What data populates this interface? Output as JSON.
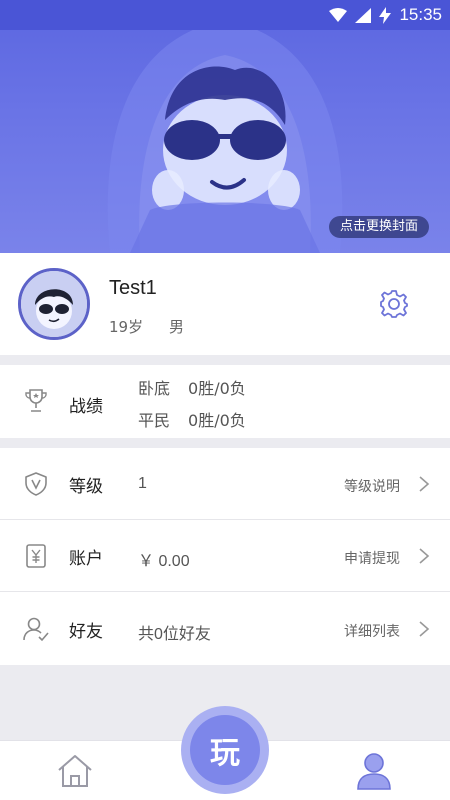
{
  "status_bar": {
    "time": "15:35",
    "icons": [
      "wifi-icon",
      "signal-icon",
      "charging-icon"
    ]
  },
  "cover": {
    "change_cover_label": "点击更换封面"
  },
  "profile": {
    "username": "Test1",
    "age": "19岁",
    "gender": "男",
    "settings_icon": "gear-icon"
  },
  "record": {
    "title": "战绩",
    "lines": [
      {
        "role": "卧底",
        "result": "0胜/0负"
      },
      {
        "role": "平民",
        "result": "0胜/0负"
      }
    ]
  },
  "rows": [
    {
      "id": "level",
      "icon": "shield-v-icon",
      "title": "等级",
      "value": "1",
      "link": "等级说明"
    },
    {
      "id": "account",
      "icon": "yen-card-icon",
      "title": "账户",
      "value": "￥ 0.00",
      "link": "申请提现"
    },
    {
      "id": "friends",
      "icon": "user-check-icon",
      "title": "好友",
      "value": "共0位好友",
      "link": "详细列表"
    }
  ],
  "bottom_nav": {
    "play_label": "玩",
    "items": [
      "home-icon",
      "profile-icon"
    ]
  },
  "colors": {
    "accent": "#5c62c8",
    "cover": "#5b66e0",
    "play": "#7d86ea",
    "icon_gray": "#888888"
  }
}
